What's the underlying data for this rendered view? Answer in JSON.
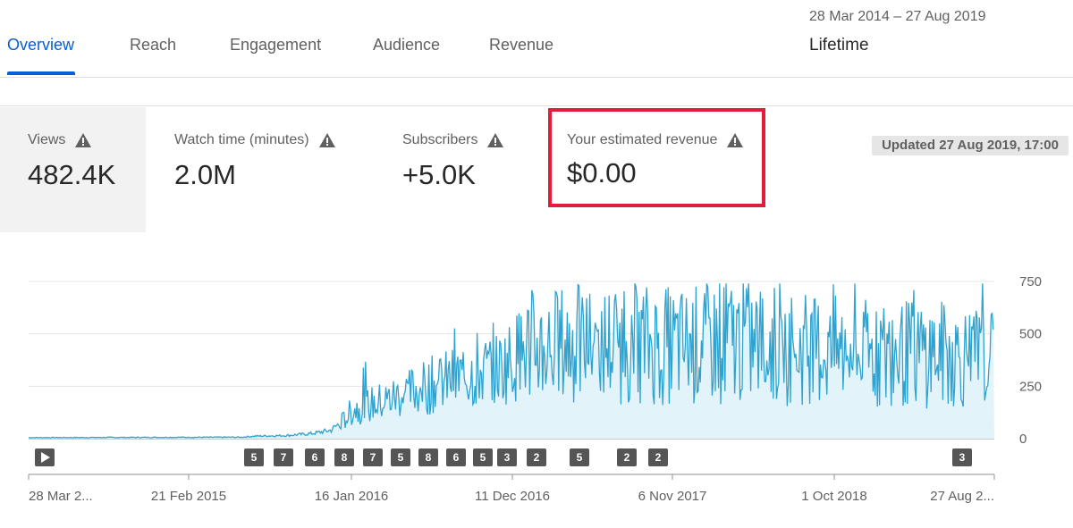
{
  "tabs": [
    {
      "label": "Overview",
      "active": true
    },
    {
      "label": "Reach",
      "active": false
    },
    {
      "label": "Engagement",
      "active": false
    },
    {
      "label": "Audience",
      "active": false
    },
    {
      "label": "Revenue",
      "active": false
    }
  ],
  "date_range": "28 Mar 2014 – 27 Aug 2019",
  "period": "Lifetime",
  "metrics": [
    {
      "label": "Views",
      "value": "482.4K",
      "warning": true,
      "selected": true
    },
    {
      "label": "Watch time (minutes)",
      "value": "2.0M",
      "warning": true,
      "selected": false
    },
    {
      "label": "Subscribers",
      "value": "+5.0K",
      "warning": true,
      "selected": false
    },
    {
      "label": "Your estimated revenue",
      "value": "$0.00",
      "warning": true,
      "selected": false,
      "highlighted": true
    }
  ],
  "updated": "Updated 27 Aug 2019, 17:00",
  "colors": {
    "accent": "#065fd4",
    "highlight": "#e41c3c",
    "series": "#2fa3cf",
    "area": "#e3f3fa"
  },
  "chart_data": {
    "type": "area",
    "series": [
      {
        "values": []
      }
    ],
    "yticks": [
      "750",
      "500",
      "250",
      "0"
    ],
    "ylim": [
      0,
      750
    ],
    "xticks": [
      "28 Mar 2...",
      "21 Feb 2015",
      "16 Jan 2016",
      "11 Dec 2016",
      "6 Nov 2017",
      "1 Oct 2018",
      "27 Aug 2..."
    ],
    "annotations": [
      "5",
      "7",
      "6",
      "8",
      "7",
      "5",
      "8",
      "6",
      "5",
      "3",
      "2",
      "5",
      "2",
      "2",
      "3"
    ],
    "profile": [
      {
        "x": "28 Mar 2014",
        "y": 5
      },
      {
        "x": "Jul 2015",
        "y": 8
      },
      {
        "x": "Oct 2015",
        "y": 30
      },
      {
        "x": "Dec 2015",
        "y": 60
      },
      {
        "x": "Jan 2016",
        "y": 140
      },
      {
        "x": "Jun 2016",
        "y": 250
      },
      {
        "x": "Nov 2016",
        "y": 330
      },
      {
        "x": "Dec 2016",
        "y": 430
      },
      {
        "x": "Nov 2017",
        "y": 450
      },
      {
        "x": "Oct 2018",
        "y": 400
      },
      {
        "x": "27 Aug 2019",
        "y": 380
      }
    ]
  }
}
